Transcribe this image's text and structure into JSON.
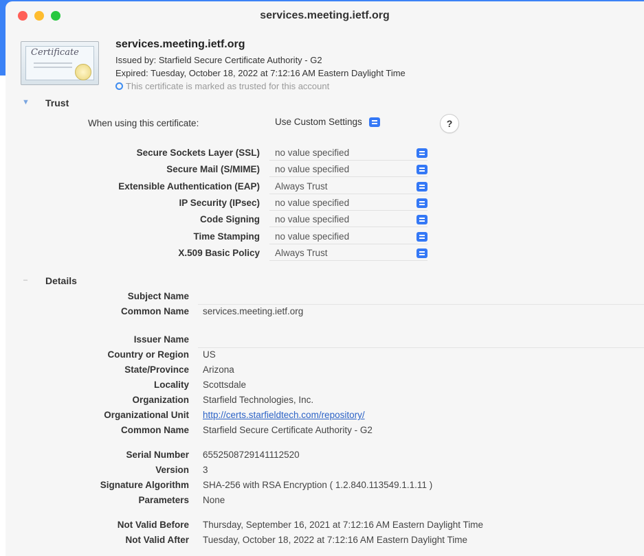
{
  "window": {
    "title": "services.meeting.ietf.org"
  },
  "certificate": {
    "icon_text": "Certificate",
    "name": "services.meeting.ietf.org",
    "issued_by": "Issued by: Starfield Secure Certificate Authority - G2",
    "expired": "Expired: Tuesday, October 18, 2022 at 7:12:16 AM Eastern Daylight Time",
    "trusted_note": "This certificate is marked as trusted for this account"
  },
  "trust": {
    "title": "Trust",
    "when_using_label": "When using this certificate:",
    "when_using_value": "Use Custom Settings",
    "help_label": "?",
    "policies": [
      {
        "label": "Secure Sockets Layer (SSL)",
        "value": "no value specified"
      },
      {
        "label": "Secure Mail (S/MIME)",
        "value": "no value specified"
      },
      {
        "label": "Extensible Authentication (EAP)",
        "value": "Always Trust"
      },
      {
        "label": "IP Security (IPsec)",
        "value": "no value specified"
      },
      {
        "label": "Code Signing",
        "value": "no value specified"
      },
      {
        "label": "Time Stamping",
        "value": "no value specified"
      },
      {
        "label": "X.509 Basic Policy",
        "value": "Always Trust"
      }
    ]
  },
  "details": {
    "title": "Details",
    "subject_header": "Subject Name",
    "subject": [
      {
        "label": "Common Name",
        "value": "services.meeting.ietf.org"
      }
    ],
    "issuer_header": "Issuer Name",
    "issuer": [
      {
        "label": "Country or Region",
        "value": "US"
      },
      {
        "label": "State/Province",
        "value": "Arizona"
      },
      {
        "label": "Locality",
        "value": "Scottsdale"
      },
      {
        "label": "Organization",
        "value": "Starfield Technologies, Inc."
      },
      {
        "label": "Organizational Unit",
        "value": "http://certs.starfieldtech.com/repository/"
      },
      {
        "label": "Common Name",
        "value": "Starfield Secure Certificate Authority - G2"
      }
    ],
    "meta": [
      {
        "label": "Serial Number",
        "value": "6552508729141112520"
      },
      {
        "label": "Version",
        "value": "3"
      },
      {
        "label": "Signature Algorithm",
        "value": "SHA-256 with RSA Encryption ( 1.2.840.113549.1.1.11 )"
      },
      {
        "label": "Parameters",
        "value": "None"
      }
    ],
    "validity": [
      {
        "label": "Not Valid Before",
        "value": "Thursday, September 16, 2021 at 7:12:16 AM Eastern Daylight Time"
      },
      {
        "label": "Not Valid After",
        "value": "Tuesday, October 18, 2022 at 7:12:16 AM Eastern Daylight Time"
      }
    ]
  },
  "colors": {
    "accent": "#3478f6",
    "link": "#2b62c6",
    "window_bg": "#f6f6f6"
  }
}
